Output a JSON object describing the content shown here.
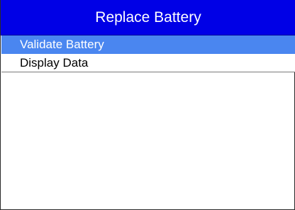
{
  "header": {
    "title": "Replace Battery"
  },
  "menu": {
    "items": [
      {
        "label": "Validate Battery",
        "selected": true
      },
      {
        "label": "Display Data",
        "selected": false
      }
    ]
  },
  "colors": {
    "title_bar": "#0000e6",
    "selection": "#4a86f0",
    "background": "#ffffff"
  }
}
